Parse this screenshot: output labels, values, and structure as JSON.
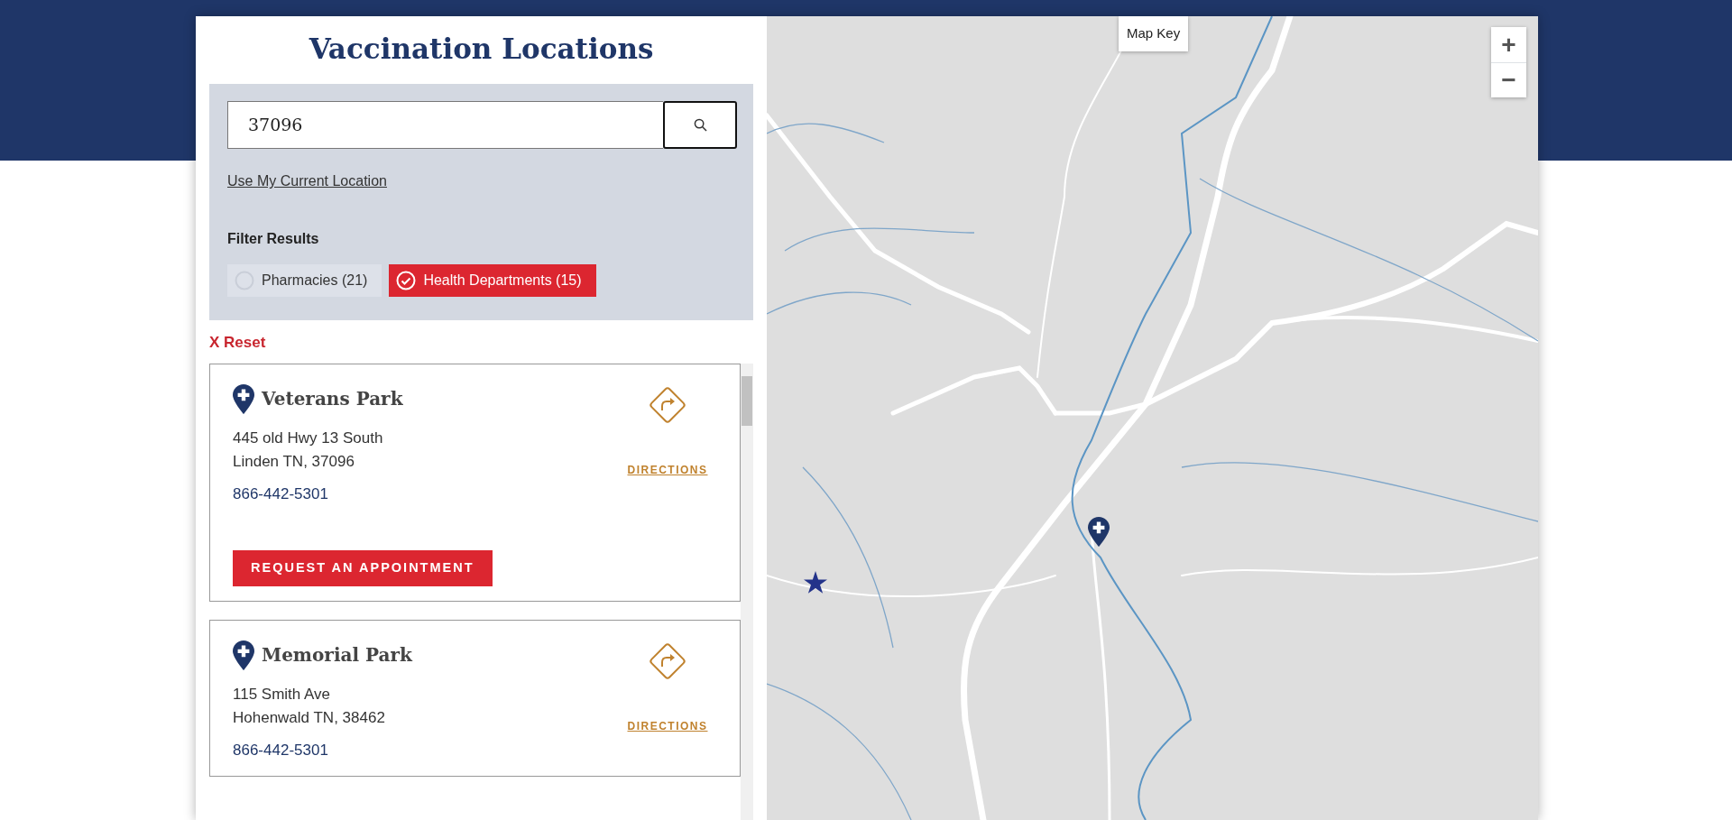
{
  "header": {
    "title": "Vaccination Locations"
  },
  "search": {
    "value": "37096"
  },
  "use_location": "Use My Current Location",
  "filter": {
    "label": "Filter Results",
    "options": [
      {
        "label": "Pharmacies (21)",
        "selected": false
      },
      {
        "label": "Health Departments (15)",
        "selected": true
      }
    ]
  },
  "reset": "X Reset",
  "locations": [
    {
      "name": "Veterans Park",
      "address_lines": [
        "445 old Hwy 13 South",
        "Linden TN, 37096"
      ],
      "phone": "866-442-5301",
      "directions": "DIRECTIONS",
      "appointment": "REQUEST AN APPOINTMENT"
    },
    {
      "name": "Memorial Park",
      "address_lines": [
        "115 Smith Ave",
        "Hohenwald TN, 38462"
      ],
      "phone": "866-442-5301",
      "directions": "DIRECTIONS"
    }
  ],
  "map": {
    "map_key": "Map Key",
    "zoom_in": "+",
    "zoom_out": "−"
  }
}
